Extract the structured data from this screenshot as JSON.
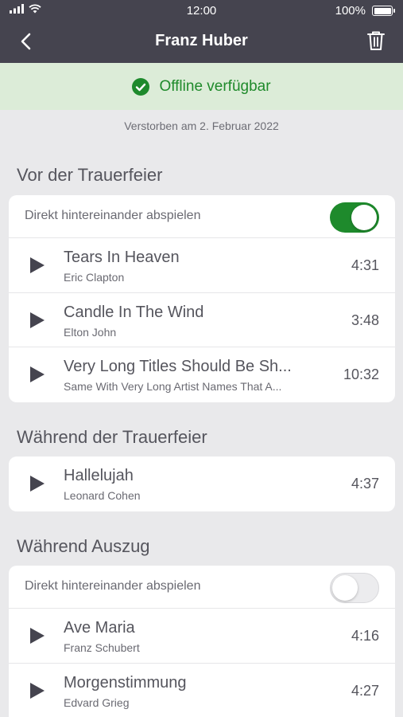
{
  "status_bar": {
    "time": "12:00",
    "battery": "100%"
  },
  "nav": {
    "title": "Franz Huber"
  },
  "offline": {
    "label": "Offline verfügbar"
  },
  "deceased_text": "Verstorben am 2. Februar 2022",
  "sections": [
    {
      "title": "Vor der Trauerfeier",
      "autoplay_label": "Direkt hintereinander abspielen",
      "autoplay_on": true,
      "tracks": [
        {
          "title": "Tears In Heaven",
          "artist": "Eric Clapton",
          "duration": "4:31"
        },
        {
          "title": "Candle In The Wind",
          "artist": "Elton John",
          "duration": "3:48"
        },
        {
          "title": "Very Long Titles Should Be Sh...",
          "artist": "Same With Very Long Artist Names That A...",
          "duration": "10:32"
        }
      ]
    },
    {
      "title": "Während der Trauerfeier",
      "tracks": [
        {
          "title": "Hallelujah",
          "artist": "Leonard Cohen",
          "duration": "4:37"
        }
      ]
    },
    {
      "title": "Während Auszug",
      "autoplay_label": "Direkt hintereinander abspielen",
      "autoplay_on": false,
      "tracks": [
        {
          "title": "Ave Maria",
          "artist": "Franz Schubert",
          "duration": "4:16"
        },
        {
          "title": "Morgenstimmung",
          "artist": "Edvard Grieg",
          "duration": "4:27"
        }
      ]
    }
  ],
  "colors": {
    "header": "#45444f",
    "accent_green": "#1e8a2c",
    "banner": "#dcecd8",
    "background": "#e9e9eb"
  },
  "icons": [
    "back-chevron-icon",
    "trash-icon",
    "check-circle-icon",
    "play-icon"
  ]
}
